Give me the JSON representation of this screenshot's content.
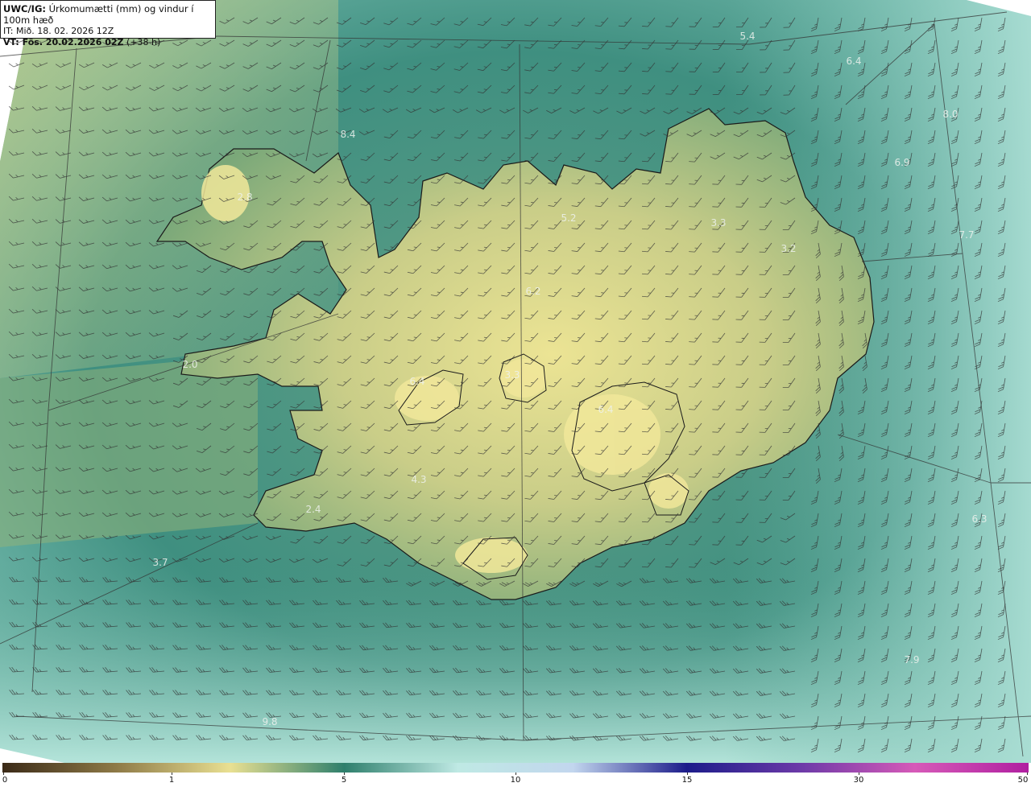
{
  "info": {
    "model": "UWC/IG:",
    "field": " Úrkomumætti (mm) og vindur í 100m hæð",
    "init": "IT: Mið. 18. 02. 2026 12Z",
    "valid": "VT: Fös. 20.02.2026 02Z",
    "lead": " (+38 h)"
  },
  "map_labels": [
    "5.4",
    "6.4",
    "8.4",
    "2.8",
    "5.2",
    "3.3",
    "3.2",
    "6.9",
    "8.0",
    "7.7",
    "6.2",
    "4.3",
    "2.4",
    "3.7",
    "6.3",
    "7.9",
    "9.8",
    "2.0",
    "6.4",
    "3.3",
    "6.4"
  ],
  "colorbar": {
    "ticks": [
      "0",
      "1",
      "5",
      "10",
      "15",
      "30",
      "50"
    ],
    "colors": [
      "#3b2a17",
      "#8e7a47",
      "#e9e092",
      "#2e7f6c",
      "#bfe9e4",
      "#c2d6ee",
      "#1c1c8a",
      "#6c3aa8",
      "#d65ab8",
      "#b01fa0"
    ]
  },
  "colors": {
    "land_light": "#e6e08e",
    "land_mid": "#8fb27a",
    "sea_teal": "#3f8f80",
    "sea_light": "#a7dccf",
    "coast": "#1a1a1a"
  }
}
